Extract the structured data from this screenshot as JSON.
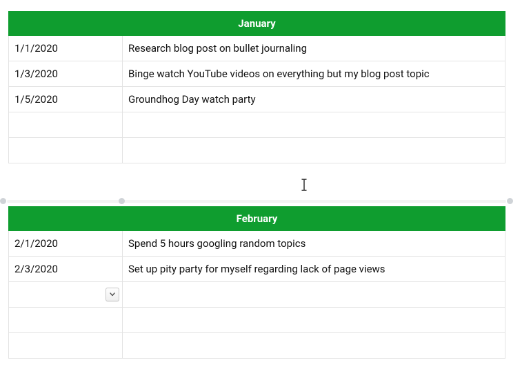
{
  "tables": [
    {
      "title": "January",
      "rows": [
        {
          "date": "1/1/2020",
          "task": "Research blog post on bullet journaling"
        },
        {
          "date": "1/3/2020",
          "task": "Binge watch YouTube videos on everything but my blog post topic"
        },
        {
          "date": "1/5/2020",
          "task": "Groundhog Day watch party"
        },
        {
          "date": "",
          "task": ""
        },
        {
          "date": "",
          "task": ""
        }
      ],
      "selected": false,
      "active_row": null
    },
    {
      "title": "February",
      "rows": [
        {
          "date": "2/1/2020",
          "task": "Spend 5 hours googling random topics"
        },
        {
          "date": "2/3/2020",
          "task": "Set up pity party for myself regarding lack of page views"
        },
        {
          "date": "",
          "task": ""
        },
        {
          "date": "",
          "task": ""
        },
        {
          "date": "",
          "task": ""
        }
      ],
      "selected": true,
      "active_row": 2
    }
  ],
  "colors": {
    "header_bg": "#0f9d2f",
    "header_fg": "#ffffff",
    "grid": "#e3e3e3"
  }
}
